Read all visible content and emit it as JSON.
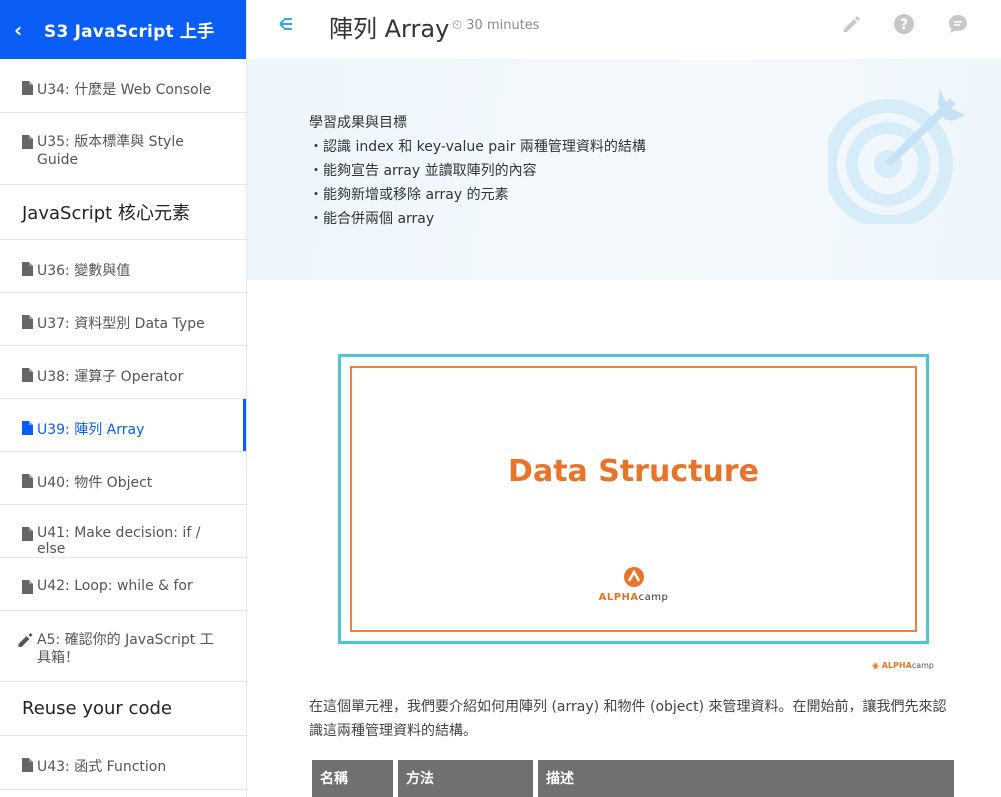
{
  "course": {
    "back_icon": "chevron-left-icon",
    "title": "S3 JavaScript 上手"
  },
  "sidebar": {
    "items": [
      {
        "type": "item",
        "label": "U34: 什麼是 Web Console",
        "icon": "document-icon",
        "active": false
      },
      {
        "type": "item",
        "label": "U35: 版本標準與 Style Guide",
        "icon": "document-icon",
        "active": false
      },
      {
        "type": "section",
        "label": "JavaScript 核心元素"
      },
      {
        "type": "item",
        "label": "U36: 變數與值",
        "icon": "document-icon",
        "active": false
      },
      {
        "type": "item",
        "label": "U37: 資料型別 Data Type",
        "icon": "document-icon",
        "active": false
      },
      {
        "type": "item",
        "label": "U38: 運算子 Operator",
        "icon": "document-icon",
        "active": false
      },
      {
        "type": "item",
        "label": "U39: 陣列 Array",
        "icon": "document-icon",
        "active": true
      },
      {
        "type": "item",
        "label": "U40: 物件 Object",
        "icon": "document-icon",
        "active": false
      },
      {
        "type": "item",
        "label": "U41: Make decision: if / else",
        "icon": "document-icon",
        "active": false
      },
      {
        "type": "item",
        "label": "U42: Loop: while & for",
        "icon": "document-icon",
        "active": false
      },
      {
        "type": "item",
        "label": "A5: 確認你的 JavaScript 工具箱！",
        "icon": "pencil-icon",
        "active": false
      },
      {
        "type": "section",
        "label": "Reuse your code"
      },
      {
        "type": "item",
        "label": "U43: 函式 Function",
        "icon": "document-icon",
        "active": false
      }
    ]
  },
  "header": {
    "menu_icon": "menu-collapse-icon",
    "title": "陣列 Array",
    "duration": "30 minutes",
    "tools": [
      "pencil-icon",
      "help-icon",
      "chat-icon"
    ]
  },
  "goals": {
    "heading": "學習成果與目標",
    "items": [
      "・認識 index 和 key-value pair 兩種管理資料的結構",
      "・能夠宣告 array 並讀取陣列的內容",
      "・能夠新增或移除 array 的元素",
      "・能合併兩個 array"
    ]
  },
  "slide": {
    "title": "Data Structure",
    "brand_bold": "ALPHA",
    "brand_light": "camp"
  },
  "intro": "在這個單元裡，我們要介紹如何用陣列 (array) 和物件 (object) 來管理資料。在開始前，讓我們先來認識這兩種管理資料的結構。",
  "table": {
    "headers": [
      "名稱",
      "方法",
      "描述"
    ]
  },
  "colors": {
    "brand_blue": "#0a5ef5",
    "accent_orange": "#e8742c",
    "slide_border": "#4ec6d0"
  }
}
